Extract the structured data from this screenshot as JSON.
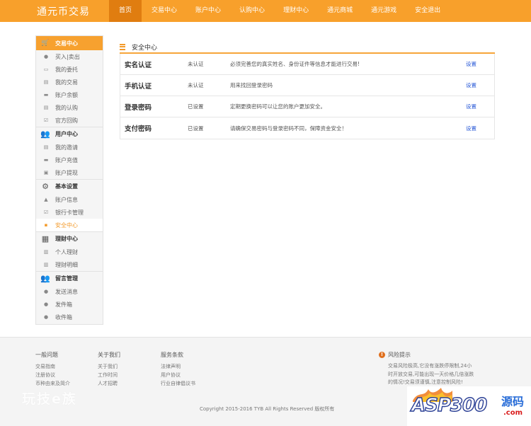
{
  "header": {
    "logo": "通元币交易",
    "nav": [
      "首页",
      "交易中心",
      "账户中心",
      "认购中心",
      "理财中心",
      "通元商城",
      "通元游戏",
      "安全退出"
    ],
    "active_index": 0
  },
  "sidebar": {
    "groups": [
      {
        "label": "交易中心",
        "icon": "cart-icon",
        "items": [
          {
            "label": "买入|卖出",
            "icon": "coin-icon"
          },
          {
            "label": "我的委托",
            "icon": "inbox-icon"
          },
          {
            "label": "我的交易",
            "icon": "list-icon"
          },
          {
            "label": "账户余额",
            "icon": "card-icon"
          },
          {
            "label": "我的认购",
            "icon": "list-icon"
          },
          {
            "label": "官方回购",
            "icon": "check-icon"
          }
        ]
      },
      {
        "label": "用户中心",
        "icon": "users-icon",
        "items": [
          {
            "label": "我的邀请",
            "icon": "list-icon"
          },
          {
            "label": "账户充值",
            "icon": "card-icon"
          },
          {
            "label": "账户提现",
            "icon": "money-icon"
          }
        ]
      },
      {
        "label": "基本设置",
        "icon": "gear-icon",
        "items": [
          {
            "label": "账户信息",
            "icon": "user-icon"
          },
          {
            "label": "银行卡管理",
            "icon": "check-icon"
          },
          {
            "label": "安全中心",
            "icon": "lock-icon",
            "active": true
          }
        ]
      },
      {
        "label": "理财中心",
        "icon": "grid-icon",
        "items": [
          {
            "label": "个人理财",
            "icon": "chart-icon"
          },
          {
            "label": "理财明细",
            "icon": "chart-icon"
          }
        ]
      },
      {
        "label": "留言管理",
        "icon": "users-icon",
        "items": [
          {
            "label": "发送消息",
            "icon": "coin-icon"
          },
          {
            "label": "发件箱",
            "icon": "coin-icon"
          },
          {
            "label": "收件箱",
            "icon": "coin-icon"
          }
        ]
      }
    ]
  },
  "main": {
    "title": "安全中心",
    "rows": [
      {
        "name": "实名认证",
        "status": "未认证",
        "desc": "必须完善您的真实姓名、身份证件等信息才能进行交易!",
        "action": "设置"
      },
      {
        "name": "手机认证",
        "status": "未认证",
        "desc": "用来找回登录密码",
        "action": "设置"
      },
      {
        "name": "登录密码",
        "status": "已设置",
        "desc": "定期更换密码可以让您的账户更加安全。",
        "action": "设置"
      },
      {
        "name": "支付密码",
        "status": "已设置",
        "desc": "请确保交易密码与登录密码不同，保障资金安全！",
        "action": "设置"
      }
    ]
  },
  "footer": {
    "columns": [
      {
        "head": "一般问题",
        "links": [
          "交易指南",
          "注册协议",
          "币种由来及简介"
        ]
      },
      {
        "head": "关于我们",
        "links": [
          "关于我们",
          "工作时间",
          "人才招聘"
        ]
      },
      {
        "head": "服务条款",
        "links": [
          "法律声明",
          "用户协议",
          "行业自律倡议书"
        ]
      }
    ],
    "risk": {
      "head": "风险提示",
      "text": "交易风险极高,它没有涨跌停限制,24小时开放交易,可能出现一天价格几倍涨跌的情况!交易须谨慎,注意控制风险!"
    },
    "copyright": "Copyright 2015-2016 TYB All Rights Reserved 版权所有",
    "watermark_left": "玩技e族",
    "watermark_right": {
      "main": "ASP300",
      "src": "源码",
      "com": ".com"
    }
  },
  "colors": {
    "brand": "#f8a02b",
    "brand_dark": "#e07d10",
    "link": "#2a5ad7"
  }
}
